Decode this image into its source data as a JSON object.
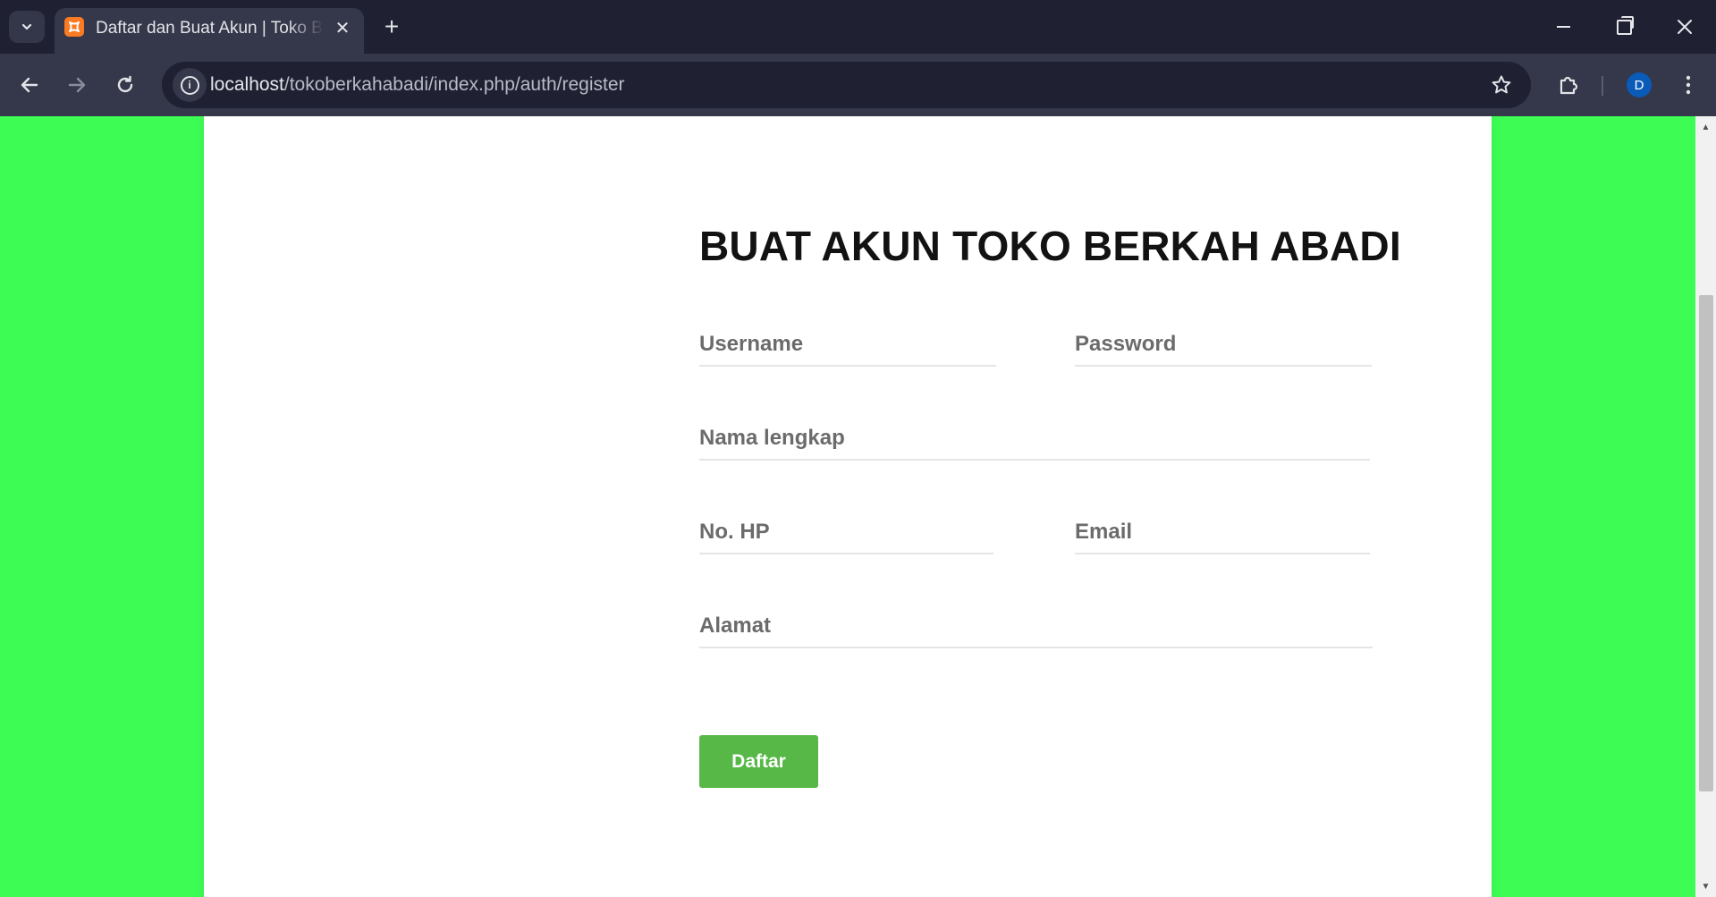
{
  "browser": {
    "tab_title": "Daftar dan Buat Akun | Toko Berkah Abadi",
    "tab_favicon_glyph": "☒",
    "tab_close_glyph": "✕",
    "new_tab_glyph": "+",
    "url_host": "localhost",
    "url_path": "/tokoberkahabadi/index.php/auth/register",
    "profile_initial": "D",
    "icons": {
      "tab_search": "chevron-down-icon",
      "back": "arrow-left-icon",
      "forward": "arrow-right-icon",
      "reload": "reload-icon",
      "site_info": "info-icon",
      "bookmark": "star-icon",
      "extensions": "puzzle-icon",
      "menu": "kebab-menu-icon",
      "minimize": "minimize-icon",
      "maximize": "restore-icon",
      "close": "close-icon"
    }
  },
  "form": {
    "title": "BUAT AKUN TOKO BERKAH ABADI",
    "fields": {
      "username": {
        "placeholder": "Username",
        "value": ""
      },
      "password": {
        "placeholder": "Password",
        "value": ""
      },
      "nama_lengkap": {
        "placeholder": "Nama lengkap",
        "value": ""
      },
      "no_hp": {
        "placeholder": "No. HP",
        "value": ""
      },
      "email": {
        "placeholder": "Email",
        "value": ""
      },
      "alamat": {
        "placeholder": "Alamat",
        "value": ""
      }
    },
    "submit_label": "Daftar"
  },
  "colors": {
    "page_background": "#3dfd54",
    "card_background": "#ffffff",
    "button_background": "#57b848",
    "chrome_dark": "#1f2133",
    "chrome_toolbar": "#35374a",
    "profile_avatar": "#0a5bb8",
    "favicon": "#fb7a24"
  }
}
